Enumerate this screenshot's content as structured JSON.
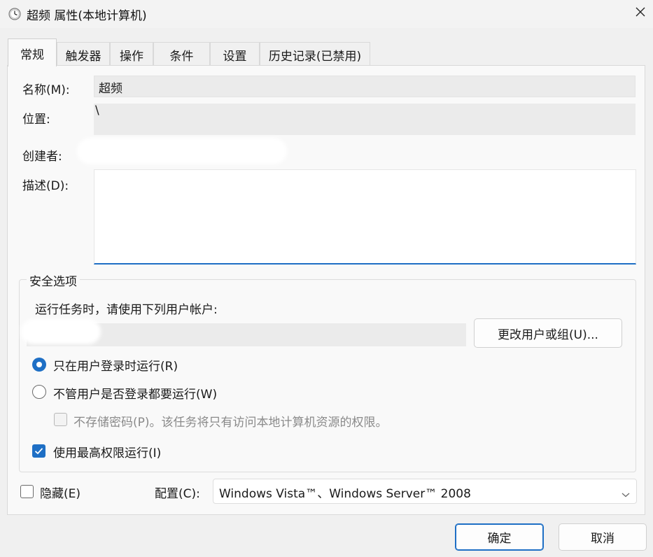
{
  "window": {
    "title": "超频 属性(本地计算机)"
  },
  "tabs": [
    {
      "label": "常规",
      "active": true
    },
    {
      "label": "触发器"
    },
    {
      "label": "操作"
    },
    {
      "label": "条件"
    },
    {
      "label": "设置"
    },
    {
      "label": "历史记录(已禁用)"
    }
  ],
  "general": {
    "name_label": "名称(M):",
    "name_value": "超频",
    "location_label": "位置:",
    "location_value": "\\",
    "author_label": "创建者:",
    "description_label": "描述(D):",
    "description_value": ""
  },
  "security": {
    "legend": "安全选项",
    "run_as_text": "运行任务时，请使用下列用户帐户:",
    "change_user_button": "更改用户或组(U)...",
    "radio_logged_on": {
      "label": "只在用户登录时运行(R)",
      "checked": true
    },
    "radio_always": {
      "label": "不管用户是否登录都要运行(W)",
      "checked": false
    },
    "dont_store_password": {
      "label": "不存储密码(P)。该任务将只有访问本地计算机资源的权限。",
      "checked": false,
      "enabled": false
    },
    "highest_privileges": {
      "label": "使用最高权限运行(I)",
      "checked": true
    }
  },
  "bottom": {
    "hidden": {
      "label": "隐藏(E)",
      "checked": false
    },
    "configure_label": "配置(C):",
    "configure_value": "Windows Vista™、Windows Server™ 2008"
  },
  "buttons": {
    "ok": "确定",
    "cancel": "取消"
  },
  "colors": {
    "accent": "#1e6fc5",
    "panel": "#f9f9f9",
    "field": "#ebebeb"
  }
}
